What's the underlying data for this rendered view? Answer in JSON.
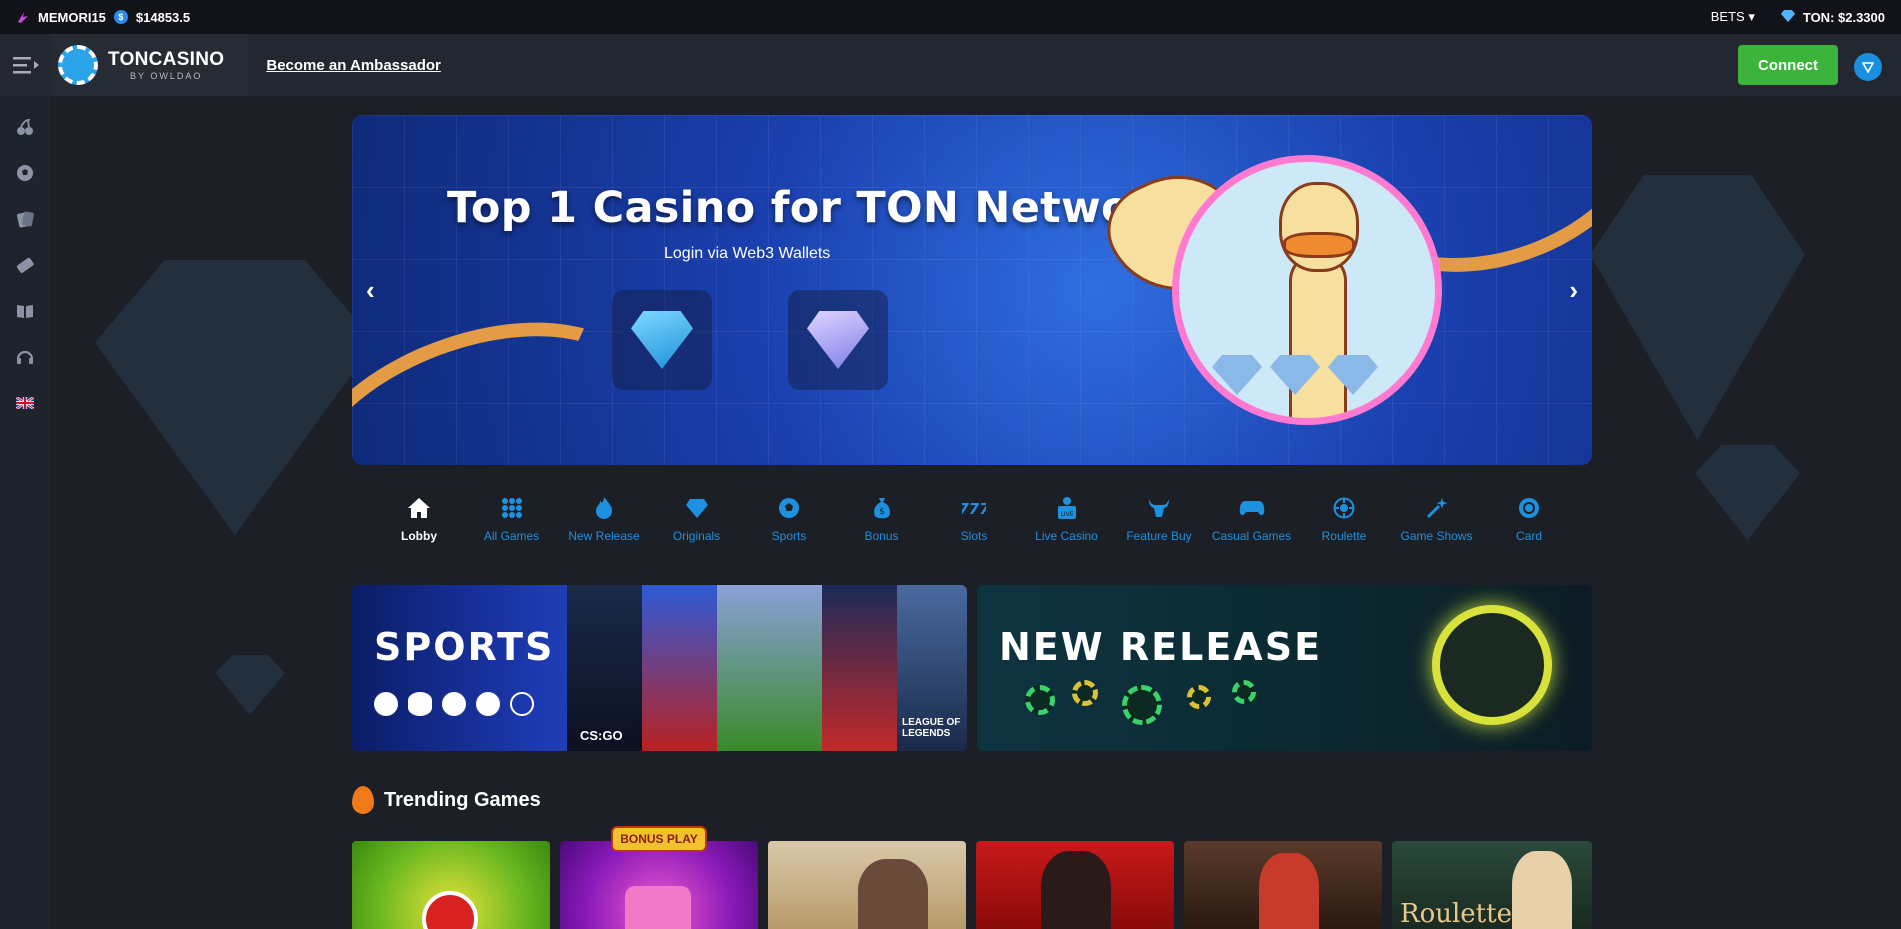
{
  "ticker": {
    "username": "MEMORI15",
    "balance": "$14853.5",
    "bets_label": "BETS",
    "ton_price": "TON: $2.3300"
  },
  "header": {
    "brand": "TONCASINO",
    "brand_sub": "BY OWLDAO",
    "ambassador_link": "Become an Ambassador",
    "connect_label": "Connect"
  },
  "sidebar": {
    "items": [
      "cherries-icon",
      "soccer-ball-icon",
      "cards-icon",
      "ticket-icon",
      "book-icon",
      "headset-icon",
      "uk-flag-icon"
    ]
  },
  "hero": {
    "title": "Top 1 Casino for TON Network",
    "subtitle": "Login via Web3 Wallets"
  },
  "categories": [
    {
      "label": "Lobby",
      "icon": "home-icon"
    },
    {
      "label": "All Games",
      "icon": "grid-icon"
    },
    {
      "label": "New Release",
      "icon": "fire-icon"
    },
    {
      "label": "Originals",
      "icon": "diamond-icon"
    },
    {
      "label": "Sports",
      "icon": "soccer-ball-icon"
    },
    {
      "label": "Bonus",
      "icon": "money-bag-icon"
    },
    {
      "label": "Slots",
      "icon": "seven-icon"
    },
    {
      "label": "Live Casino",
      "icon": "live-dealer-icon"
    },
    {
      "label": "Feature Buy",
      "icon": "bull-icon"
    },
    {
      "label": "Casual Games",
      "icon": "gamepad-icon"
    },
    {
      "label": "Roulette",
      "icon": "roulette-icon"
    },
    {
      "label": "Game Shows",
      "icon": "magic-wand-icon"
    },
    {
      "label": "Card",
      "icon": "chip-icon"
    }
  ],
  "promos": {
    "sports_title": "SPORTS",
    "sports_brand_1": "CS:GO",
    "sports_brand_2": "LEAGUE OF LEGENDS",
    "release_title": "NEW RELEASE"
  },
  "trending": {
    "title": "Trending Games",
    "badge": "BONUS PLAY",
    "roulette_label": "Roulette"
  },
  "colors": {
    "accent_blue": "#1e90e0",
    "connect_green": "#3cb43c",
    "background": "#1c1f26"
  }
}
